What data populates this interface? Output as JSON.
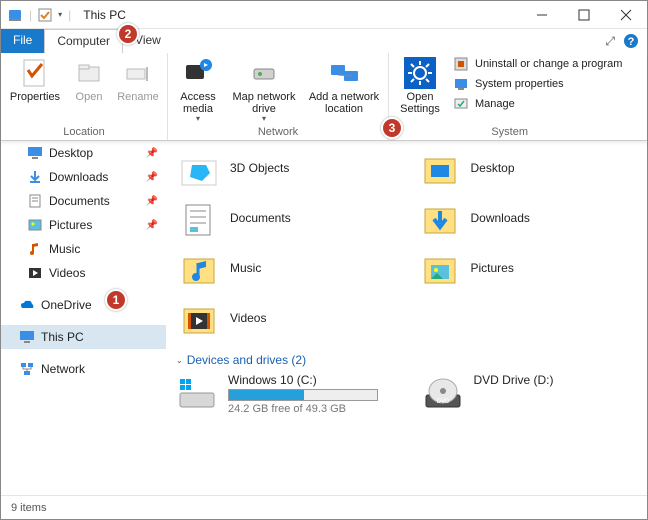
{
  "title": "This PC",
  "tabs": {
    "file": "File",
    "computer": "Computer",
    "view": "View"
  },
  "ribbon": {
    "location": {
      "label": "Location",
      "properties": "Properties",
      "open": "Open",
      "rename": "Rename"
    },
    "network": {
      "label": "Network",
      "access_media": "Access media",
      "map_drive": "Map network drive",
      "add_location": "Add a network location"
    },
    "system": {
      "label": "System",
      "open_settings": "Open Settings",
      "uninstall": "Uninstall or change a program",
      "sys_props": "System properties",
      "manage": "Manage"
    }
  },
  "nav": {
    "desktop": "Desktop",
    "downloads": "Downloads",
    "documents": "Documents",
    "pictures": "Pictures",
    "music": "Music",
    "videos": "Videos",
    "onedrive": "OneDrive",
    "this_pc": "This PC",
    "network": "Network"
  },
  "folders": {
    "threed": "3D Objects",
    "desktop": "Desktop",
    "documents": "Documents",
    "downloads": "Downloads",
    "music": "Music",
    "pictures": "Pictures",
    "videos": "Videos"
  },
  "section": {
    "devices": "Devices and drives (2)"
  },
  "drives": {
    "c": {
      "name": "Windows 10 (C:)",
      "free": "24.2 GB free of 49.3 GB",
      "fill_pct": 51
    },
    "d": {
      "name": "DVD Drive (D:)"
    }
  },
  "status": {
    "items": "9 items"
  },
  "badges": {
    "one": "1",
    "two": "2",
    "three": "3"
  }
}
